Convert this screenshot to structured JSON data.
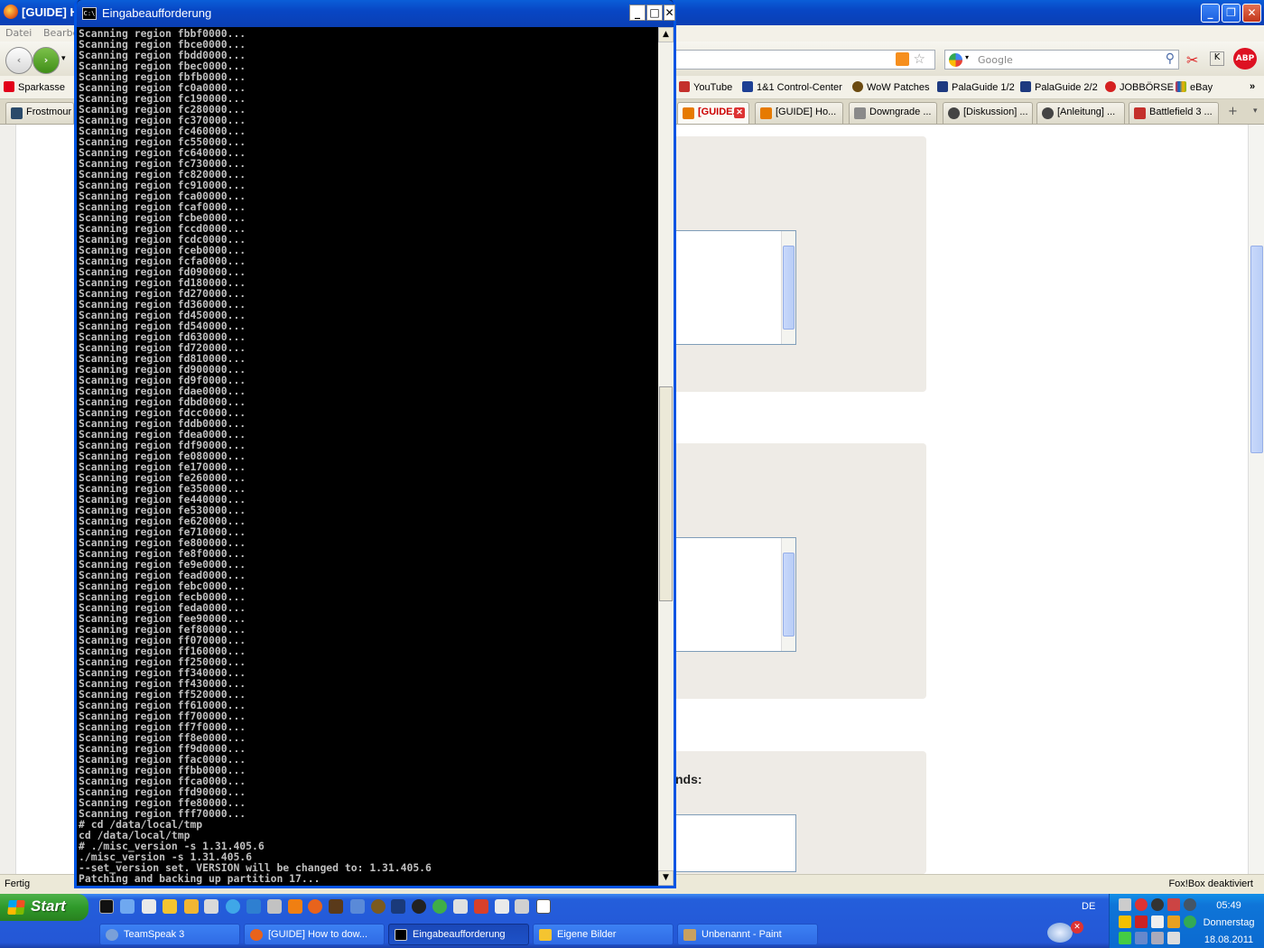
{
  "firefox": {
    "title": "[GUIDE] H",
    "menu": [
      "Datei",
      "Bearbe"
    ],
    "search_placeholder": "Google",
    "bookmarks_left": "Sparkasse",
    "bookmarks": [
      "YouTube",
      "1&1 Control-Center",
      "WoW Patches",
      "PalaGuide 1/2",
      "PalaGuide 2/2",
      "JOBBÖRSE",
      "eBay"
    ],
    "tab_left": "Frostmour",
    "tabs": [
      "[GUIDE...",
      "[GUIDE] Ho...",
      "Downgrade ...",
      "[Diskussion] ...",
      "[Anleitung] ...",
      "Battlefield 3 ..."
    ],
    "content_label": "nds:",
    "status_left": "Fertig",
    "status_right": "Fox!Box deaktiviert"
  },
  "cmd": {
    "title": "Eingabeaufforderung",
    "lines": [
      "Scanning region fbbf0000...",
      "Scanning region fbce0000...",
      "Scanning region fbdd0000...",
      "Scanning region fbec0000...",
      "Scanning region fbfb0000...",
      "Scanning region fc0a0000...",
      "Scanning region fc190000...",
      "Scanning region fc280000...",
      "Scanning region fc370000...",
      "Scanning region fc460000...",
      "Scanning region fc550000...",
      "Scanning region fc640000...",
      "Scanning region fc730000...",
      "Scanning region fc820000...",
      "Scanning region fc910000...",
      "Scanning region fca00000...",
      "Scanning region fcaf0000...",
      "Scanning region fcbe0000...",
      "Scanning region fccd0000...",
      "Scanning region fcdc0000...",
      "Scanning region fceb0000...",
      "Scanning region fcfa0000...",
      "Scanning region fd090000...",
      "Scanning region fd180000...",
      "Scanning region fd270000...",
      "Scanning region fd360000...",
      "Scanning region fd450000...",
      "Scanning region fd540000...",
      "Scanning region fd630000...",
      "Scanning region fd720000...",
      "Scanning region fd810000...",
      "Scanning region fd900000...",
      "Scanning region fd9f0000...",
      "Scanning region fdae0000...",
      "Scanning region fdbd0000...",
      "Scanning region fdcc0000...",
      "Scanning region fddb0000...",
      "Scanning region fdea0000...",
      "Scanning region fdf90000...",
      "Scanning region fe080000...",
      "Scanning region fe170000...",
      "Scanning region fe260000...",
      "Scanning region fe350000...",
      "Scanning region fe440000...",
      "Scanning region fe530000...",
      "Scanning region fe620000...",
      "Scanning region fe710000...",
      "Scanning region fe800000...",
      "Scanning region fe8f0000...",
      "Scanning region fe9e0000...",
      "Scanning region fead0000...",
      "Scanning region febc0000...",
      "Scanning region fecb0000...",
      "Scanning region feda0000...",
      "Scanning region fee90000...",
      "Scanning region fef80000...",
      "Scanning region ff070000...",
      "Scanning region ff160000...",
      "Scanning region ff250000...",
      "Scanning region ff340000...",
      "Scanning region ff430000...",
      "Scanning region ff520000...",
      "Scanning region ff610000...",
      "Scanning region ff700000...",
      "Scanning region ff7f0000...",
      "Scanning region ff8e0000...",
      "Scanning region ff9d0000...",
      "Scanning region ffac0000...",
      "Scanning region ffbb0000...",
      "Scanning region ffca0000...",
      "Scanning region ffd90000...",
      "Scanning region ffe80000...",
      "Scanning region fff70000...",
      "# cd /data/local/tmp",
      "cd /data/local/tmp",
      "# ./misc_version -s 1.31.405.6",
      "./misc_version -s 1.31.405.6",
      "--set_version set. VERSION will be changed to: 1.31.405.6",
      "Patching and backing up partition 17..."
    ]
  },
  "taskbar": {
    "start_label": "Start",
    "tasks": [
      "TeamSpeak 3",
      "[GUIDE] How to dow...",
      "Eingabeaufforderung",
      "Eigene Bilder",
      "Unbenannt - Paint"
    ],
    "active_task": 2,
    "language": "DE",
    "time": "05:49",
    "day": "Donnerstag",
    "date": "18.08.2011"
  },
  "colors": {
    "xp_blue": "#0846c4",
    "console_bg": "#000000",
    "console_text": "#c0c0c0",
    "start_green": "#2f9a2a"
  }
}
